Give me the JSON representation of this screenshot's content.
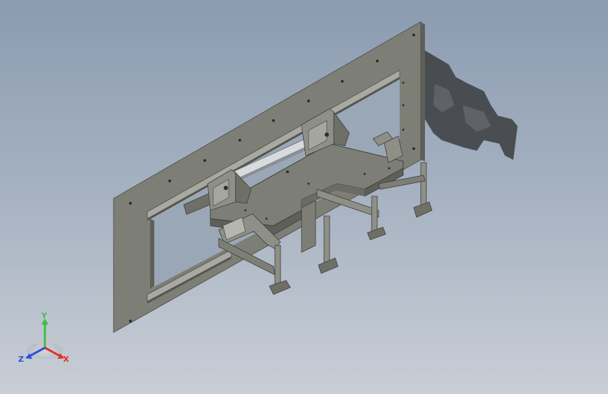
{
  "viewport": {
    "background_top": "#8b9bb0",
    "background_bottom": "#c9ced6"
  },
  "triad": {
    "x_label": "X",
    "y_label": "Y",
    "z_label": "Z",
    "x_color": "#e0322d",
    "y_color": "#3fbf3f",
    "z_color": "#2f4fd8"
  },
  "model": {
    "plate_color": "#7d7e76",
    "plate_edge_color": "#55564f",
    "rail_color": "#a8a9a1",
    "hardware_color": "#6e6f66",
    "shadow_color": "#3c3d3f"
  }
}
